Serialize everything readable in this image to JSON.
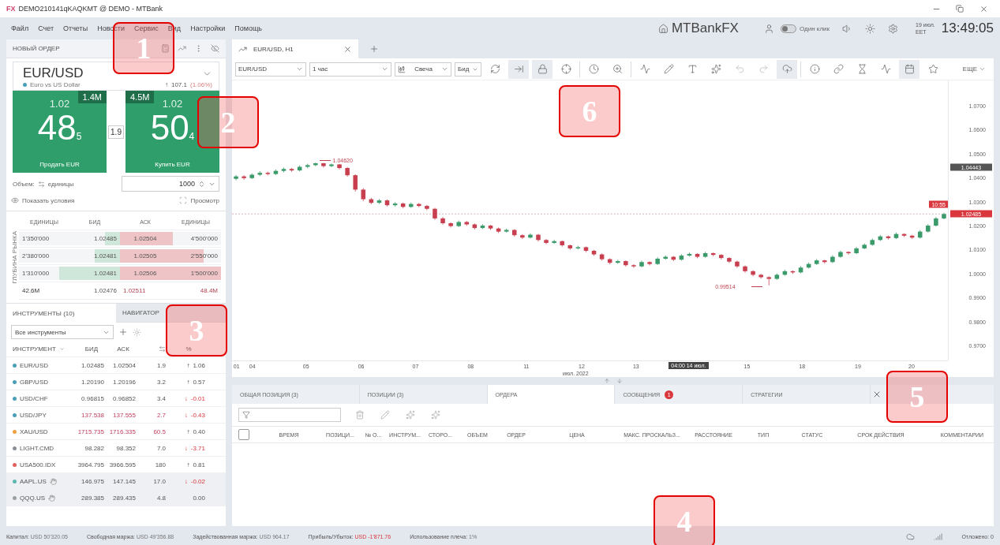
{
  "window": {
    "logo": "FX",
    "title": "DEMO210141qKAQKMT @ DEMO - MTBank"
  },
  "menu": [
    "Файл",
    "Счет",
    "Отчеты",
    "Новости",
    "Сервис",
    "Вид",
    "Настройки",
    "Помощь"
  ],
  "header": {
    "brand": "MTBankFX",
    "one_click": {
      "label": "Один клик",
      "on": false
    },
    "date": "19 июл.",
    "timezone": "EET",
    "time": "13:49:05"
  },
  "order": {
    "title": "НОВЫЙ ОРДЕР",
    "symbol": "EUR/USD",
    "description": "Euro vs US Dollar",
    "change_arrow": "↑",
    "change": "107.1",
    "change_percent": "(1.06%)",
    "sell": {
      "volume": "1.4M",
      "big": "1.02",
      "pips": "48",
      "pipette": "5",
      "label": "Продать EUR"
    },
    "buy": {
      "volume": "4.5M",
      "big": "1.02",
      "pips": "50",
      "pipette": "4",
      "label": "Купить EUR"
    },
    "spread": "1.9",
    "volume_label": "Объем:",
    "volume_unit": "единицы",
    "volume_value": "1000",
    "show_conditions": "Показать условия",
    "preview": "Просмотр"
  },
  "depth": {
    "title": "ГЛУБИНА РЫНКА",
    "columns": [
      "ЕДИНИЦЫ",
      "БИД",
      "АСК",
      "ЕДИНИЦЫ"
    ],
    "rows": [
      {
        "bid_units": "1'350'000",
        "bid": "1.02485",
        "ask": "1.02504",
        "ask_units": "4'500'000",
        "bid_depth": {
          "level": 0.15
        },
        "ask_depth": {
          "level": 0.52
        }
      },
      {
        "bid_units": "2'380'000",
        "bid": "1.02481",
        "ask": "1.02505",
        "ask_units": "2'550'000",
        "bid_depth": {
          "level": 0.25
        },
        "ask_depth": {
          "level": 0.83
        }
      },
      {
        "bid_units": "1'310'000",
        "bid": "1.02481",
        "ask": "1.02506",
        "ask_units": "1'500'000",
        "bid_depth": {
          "level": 0.6
        },
        "ask_depth": {
          "level": 1
        }
      }
    ],
    "totals": {
      "bid_units": "42.6M",
      "bid": "1.02476",
      "ask": "1.02511",
      "ask_units": "48.4M"
    }
  },
  "instruments": {
    "tabs": [
      {
        "label": "ИНСТРУМЕНТЫ (10)",
        "selected": true
      },
      {
        "label": "НАВИГАТОР",
        "selected": false
      }
    ],
    "filter": "Все инструменты",
    "columns": [
      {
        "label": "ИНСТРУМЕНТ",
        "sorted": true
      },
      {
        "label": "БИД",
        "sorted": false
      },
      {
        "label": "АСК",
        "sorted": false
      },
      {
        "label": "%",
        "sorted": false
      }
    ],
    "rows": [
      {
        "name": "EUR/USD",
        "color": "#4a9fb5",
        "bid": "1.02485",
        "ask": "1.02504",
        "spread": "1.9",
        "arrow": "↑",
        "change": "1.06",
        "negative": false,
        "flash": false,
        "closed": false
      },
      {
        "name": "GBP/USD",
        "color": "#4a9fb5",
        "bid": "1.20190",
        "ask": "1.20196",
        "spread": "3.2",
        "arrow": "↑",
        "change": "0.57",
        "negative": false,
        "flash": false,
        "closed": false
      },
      {
        "name": "USD/CHF",
        "color": "#4a9fb5",
        "bid": "0.96815",
        "ask": "0.96852",
        "spread": "3.4",
        "arrow": "↓",
        "change": "-0.01",
        "negative": true,
        "flash": false,
        "closed": false
      },
      {
        "name": "USD/JPY",
        "color": "#4a9fb5",
        "bid": "137.538",
        "ask": "137.555",
        "spread": "2.7",
        "arrow": "↓",
        "change": "-0.43",
        "negative": true,
        "flash": true,
        "closed": false
      },
      {
        "name": "XAU/USD",
        "color": "#f0a040",
        "bid": "1715.735",
        "ask": "1716.335",
        "spread": "60.5",
        "arrow": "↑",
        "change": "0.40",
        "negative": false,
        "flash": true,
        "closed": false
      },
      {
        "name": "LIGHT.CMD",
        "color": "#8a8f96",
        "bid": "98.282",
        "ask": "98.352",
        "spread": "7.0",
        "arrow": "↓",
        "change": "-3.71",
        "negative": true,
        "flash": false,
        "closed": false
      },
      {
        "name": "USA500.IDX",
        "color": "#e06060",
        "bid": "3964.795",
        "ask": "3966.595",
        "spread": "180",
        "arrow": "↑",
        "change": "0.81",
        "negative": false,
        "flash": false,
        "closed": false
      },
      {
        "name": "AAPL.US",
        "color": "#5cb8b0",
        "bid": "146.975",
        "ask": "147.145",
        "spread": "17.0",
        "arrow": "↓",
        "change": "-0.02",
        "negative": true,
        "flash": false,
        "closed": true
      },
      {
        "name": "QQQ.US",
        "color": "#9aa0a6",
        "bid": "289.385",
        "ask": "289.435",
        "spread": "4.8",
        "change": "0.00",
        "negative": false,
        "flash": false,
        "closed": true
      }
    ]
  },
  "chart": {
    "tab": "EUR/USD, H1",
    "symbol": "EUR/USD",
    "timeframe": "1 час",
    "style": "Свеча",
    "price_type": "Бид",
    "more": "ЕЩЕ",
    "marker_price": "1.04443",
    "current_time": "10:55",
    "current_price": "1.02485",
    "high_label": "1.04620",
    "low_label": "0.99514",
    "month": "июл. 2022",
    "cursor_time": "04:00 14 июл.",
    "time_labels": [
      "01",
      "04",
      "05",
      "06",
      "07",
      "08",
      "11",
      "12",
      "13",
      "15",
      "18",
      "19",
      "20"
    ],
    "chart_data": {
      "type": "candlestick",
      "ylim": [
        0.9638,
        1.0805
      ],
      "ref_lines": [
        {
          "axis": "y",
          "value": 1.02485
        }
      ],
      "yticks": [
        {
          "value": 1.07,
          "label": "1.0700"
        },
        {
          "value": 1.06,
          "label": "1.0600"
        },
        {
          "value": 1.05,
          "label": "1.0500"
        },
        {
          "value": 1.04,
          "label": "1.0400"
        },
        {
          "value": 1.03,
          "label": "1.0300"
        },
        {
          "value": 1.02,
          "label": "1.0200"
        },
        {
          "value": 1.01,
          "label": "1.0100"
        },
        {
          "value": 1.0,
          "label": "1.0000"
        },
        {
          "value": 0.99,
          "label": "0.9900"
        },
        {
          "value": 0.98,
          "label": "0.9800"
        },
        {
          "value": 0.97,
          "label": "0.9700"
        }
      ],
      "categories": [
        null,
        null,
        null,
        null,
        null,
        null,
        null,
        null,
        null,
        null,
        null,
        null,
        null,
        null,
        null,
        null,
        null,
        null,
        null,
        null,
        null,
        null,
        null,
        null,
        null,
        null,
        null,
        null,
        null,
        null,
        null,
        null,
        null,
        null,
        null,
        null,
        null,
        null,
        null,
        null,
        null,
        null,
        null,
        null,
        null,
        null,
        null,
        null,
        null,
        null,
        null,
        null,
        null,
        null,
        null,
        null,
        null,
        null,
        null,
        null,
        null,
        null,
        null,
        null,
        null,
        null,
        null,
        null,
        null,
        null,
        null,
        null,
        null,
        null,
        null,
        null,
        null,
        null,
        null,
        null,
        null,
        null,
        null,
        null,
        null,
        null,
        null,
        null,
        null,
        null
      ],
      "ohlc": [
        [
          1.0395,
          1.0411,
          1.0389,
          1.0405
        ],
        [
          1.0405,
          1.041,
          1.0391,
          1.0398
        ],
        [
          1.0398,
          1.0418,
          1.0394,
          1.0412
        ],
        [
          1.0412,
          1.0427,
          1.0406,
          1.042
        ],
        [
          1.042,
          1.0425,
          1.0409,
          1.0415
        ],
        [
          1.0415,
          1.0434,
          1.0411,
          1.0428
        ],
        [
          1.0428,
          1.0442,
          1.0422,
          1.0436
        ],
        [
          1.0436,
          1.044,
          1.0424,
          1.043
        ],
        [
          1.043,
          1.0451,
          1.0426,
          1.0445
        ],
        [
          1.0445,
          1.0458,
          1.0439,
          1.0452
        ],
        [
          1.0452,
          1.0462,
          1.0447,
          1.046
        ],
        [
          1.046,
          1.0461,
          1.0442,
          1.0448
        ],
        [
          1.0448,
          1.0459,
          1.0443,
          1.0455
        ],
        [
          1.0455,
          1.0457,
          1.0434,
          1.044
        ],
        [
          1.044,
          1.0444,
          1.0404,
          1.041
        ],
        [
          1.041,
          1.0414,
          1.0342,
          1.035
        ],
        [
          1.035,
          1.0356,
          1.0302,
          1.031
        ],
        [
          1.031,
          1.0316,
          1.0289,
          1.0295
        ],
        [
          1.0295,
          1.0311,
          1.029,
          1.0305
        ],
        [
          1.0305,
          1.0309,
          1.028,
          1.0285
        ],
        [
          1.0285,
          1.0298,
          1.0279,
          1.0292
        ],
        [
          1.0292,
          1.0296,
          1.0272,
          1.0278
        ],
        [
          1.0278,
          1.0296,
          1.0274,
          1.029
        ],
        [
          1.029,
          1.0294,
          1.0276,
          1.0282
        ],
        [
          1.0282,
          1.0286,
          1.0264,
          1.027
        ],
        [
          1.027,
          1.0274,
          1.0224,
          1.023
        ],
        [
          1.023,
          1.0236,
          1.0204,
          1.021
        ],
        [
          1.021,
          1.0214,
          1.0192,
          1.0198
        ],
        [
          1.0198,
          1.0221,
          1.0194,
          1.0215
        ],
        [
          1.0215,
          1.0219,
          1.0199,
          1.0205
        ],
        [
          1.0205,
          1.0209,
          1.0184,
          1.019
        ],
        [
          1.019,
          1.0206,
          1.0186,
          1.02
        ],
        [
          1.02,
          1.0203,
          1.0182,
          1.0188
        ],
        [
          1.0188,
          1.0192,
          1.0169,
          1.0175
        ],
        [
          1.0175,
          1.0188,
          1.0171,
          1.0182
        ],
        [
          1.0182,
          1.0185,
          1.0154,
          1.016
        ],
        [
          1.016,
          1.0164,
          1.0144,
          1.015
        ],
        [
          1.015,
          1.0168,
          1.0146,
          1.0162
        ],
        [
          1.0162,
          1.0165,
          1.0134,
          1.014
        ],
        [
          1.014,
          1.0144,
          1.0122,
          1.0128
        ],
        [
          1.0128,
          1.0141,
          1.0124,
          1.0135
        ],
        [
          1.0135,
          1.0138,
          1.0112,
          1.0118
        ],
        [
          1.0118,
          1.0121,
          1.0099,
          1.0105
        ],
        [
          1.0105,
          1.0116,
          1.0101,
          1.011
        ],
        [
          1.011,
          1.0113,
          1.0089,
          1.0095
        ],
        [
          1.0095,
          1.0099,
          1.0074,
          1.008
        ],
        [
          1.008,
          1.0084,
          1.0054,
          1.006
        ],
        [
          1.006,
          1.0064,
          1.0039,
          1.0045
        ],
        [
          1.0045,
          1.0058,
          1.0041,
          1.0052
        ],
        [
          1.0052,
          1.0055,
          1.0029,
          1.0035
        ],
        [
          1.0035,
          1.0039,
          1.0024,
          1.003
        ],
        [
          1.003,
          1.0054,
          1.0026,
          1.0048
        ],
        [
          1.0048,
          1.0051,
          1.0034,
          1.004
        ],
        [
          1.004,
          1.0068,
          1.0036,
          1.0062
        ],
        [
          1.0062,
          1.0076,
          1.0058,
          1.007
        ],
        [
          1.007,
          1.0073,
          1.0052,
          1.0058
        ],
        [
          1.0058,
          1.0081,
          1.0054,
          1.0075
        ],
        [
          1.0075,
          1.0088,
          1.0071,
          1.0082
        ],
        [
          1.0082,
          1.0085,
          1.0064,
          1.007
        ],
        [
          1.007,
          1.0091,
          1.0066,
          1.0085
        ],
        [
          1.0085,
          1.0088,
          1.0072,
          1.0078
        ],
        [
          1.0078,
          1.0081,
          1.0059,
          1.0065
        ],
        [
          1.0065,
          1.0068,
          1.0044,
          1.005
        ],
        [
          1.005,
          1.0054,
          1.0024,
          1.003
        ],
        [
          1.003,
          1.0034,
          1.0004,
          1.001
        ],
        [
          1.001,
          1.0014,
          0.9989,
          0.9995
        ],
        [
          0.9995,
          0.9999,
          0.9979,
          0.9985
        ],
        [
          0.9985,
          0.9989,
          0.9951,
          0.9978
        ],
        [
          0.9978,
          1.0001,
          0.9974,
          0.9995
        ],
        [
          0.9995,
          1.0016,
          0.9991,
          1.001
        ],
        [
          1.001,
          1.0013,
          0.9999,
          1.0005
        ],
        [
          1.0005,
          1.0031,
          1.0001,
          1.0025
        ],
        [
          1.0025,
          1.0046,
          1.0021,
          1.004
        ],
        [
          1.004,
          1.0061,
          1.0036,
          1.0055
        ],
        [
          1.0055,
          1.0058,
          1.0042,
          1.0048
        ],
        [
          1.0048,
          1.0076,
          1.0044,
          1.007
        ],
        [
          1.007,
          1.0096,
          1.0066,
          1.009
        ],
        [
          1.009,
          1.0093,
          1.0079,
          1.0085
        ],
        [
          1.0085,
          1.0111,
          1.0081,
          1.0105
        ],
        [
          1.0105,
          1.0126,
          1.0101,
          1.012
        ],
        [
          1.012,
          1.0146,
          1.0116,
          1.014
        ],
        [
          1.014,
          1.0161,
          1.0136,
          1.0155
        ],
        [
          1.0155,
          1.0158,
          1.0142,
          1.0148
        ],
        [
          1.0148,
          1.0171,
          1.0144,
          1.0165
        ],
        [
          1.0165,
          1.0168,
          1.0152,
          1.0158
        ],
        [
          1.0158,
          1.0161,
          1.0144,
          1.015
        ],
        [
          1.015,
          1.0181,
          1.0146,
          1.0175
        ],
        [
          1.0175,
          1.0206,
          1.0171,
          1.02
        ],
        [
          1.02,
          1.0236,
          1.0196,
          1.023
        ],
        [
          1.023,
          1.0254,
          1.0226,
          1.0248
        ]
      ]
    }
  },
  "bottom": {
    "tabs": [
      {
        "label": "ОБЩАЯ ПОЗИЦИЯ (3)",
        "selected": false
      },
      {
        "label": "ПОЗИЦИИ (3)",
        "selected": false
      },
      {
        "label": "ОРДЕРА",
        "selected": true
      },
      {
        "label": "СООБЩЕНИЯ",
        "selected": false,
        "badge": "1"
      },
      {
        "label": "СТРАТЕГИИ",
        "selected": false
      }
    ],
    "select_all": {
      "checked": false
    },
    "columns": [
      "ВРЕМЯ",
      "ПОЗИЦИ...",
      "№ О...",
      "ИНСТРУМ...",
      "СТОРО...",
      "ОБЪЕМ",
      "ОРДЕР",
      "ЦЕНА",
      "МАКС. ПРОСКАЛЬЗ...",
      "РАССТОЯНИЕ",
      "ТИП",
      "СТАТУС",
      "СРОК ДЕЙСТВИЯ",
      "КОММЕНТАРИИ"
    ]
  },
  "status": {
    "items": [
      {
        "label": "Капитал:",
        "value": "USD 50'320.05",
        "negative": false
      },
      {
        "label": "Свободная маржа:",
        "value": "USD 49'356.88",
        "negative": false
      },
      {
        "label": "Задействованная маржа:",
        "value": "USD 964.17",
        "negative": false
      },
      {
        "label": "Прибыль/Убыток:",
        "value": "USD -1'871.76",
        "negative": true
      },
      {
        "label": "Использование плеча:",
        "value": "1%",
        "negative": false
      }
    ],
    "pending": "Отложено: 0"
  },
  "callouts": [
    "1",
    "2",
    "3",
    "4",
    "5",
    "6"
  ]
}
